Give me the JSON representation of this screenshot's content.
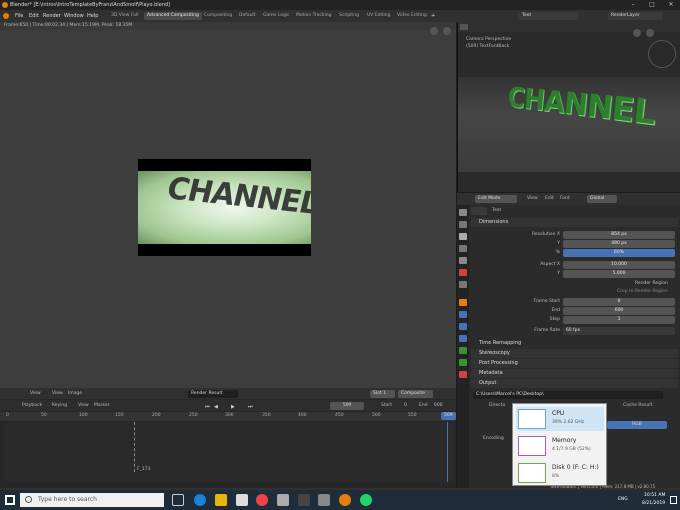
{
  "window": {
    "title": "Blender* [E:\\intros\\IntroTemplateByFranziAndSmolf\\Playo.blend]"
  },
  "menus": [
    "File",
    "Edit",
    "Render",
    "Window",
    "Help"
  ],
  "workspaces": [
    "3D View Full",
    "Advanced Compositing",
    "Compositing",
    "Default",
    "Game Logic",
    "Motion Tracking",
    "Scripting",
    "UV Editing",
    "Video Editing"
  ],
  "active_workspace_index": 1,
  "scene_name": "Text",
  "view_layer": "RenderLayer",
  "render_view": {
    "status": "Frame:650 | Time:00:02.34 | Mem:15.19M, Peak: 18.35M",
    "render_word": "CHANNEL"
  },
  "camera_view": {
    "label": "Camera Perspective",
    "sublabel": "(509) TextFontBack",
    "word": "CHANNEL"
  },
  "edit_header": {
    "mode": "Edit Mode",
    "items": [
      "View",
      "Edit",
      "Font"
    ],
    "orientation": "Global"
  },
  "properties": {
    "object_name": "Text",
    "dimensions_title": "Dimensions",
    "rows": [
      {
        "label": "Resolution X",
        "value": "854 px"
      },
      {
        "label": "Y",
        "value": "480 px"
      },
      {
        "label": "%",
        "value": "60%"
      },
      {
        "label": "Aspect X",
        "value": "10.000"
      },
      {
        "label": "Y",
        "value": "5.000"
      },
      {
        "label": "Frame Start",
        "value": "0"
      },
      {
        "label": "End",
        "value": "600"
      },
      {
        "label": "Step",
        "value": "1"
      },
      {
        "label": "Frame Rate",
        "value": "60 fps"
      }
    ],
    "render_region": "Render Region",
    "crop_region": "Crop to Render Region",
    "sections": [
      "Time Remapping",
      "Stereoscopy",
      "Post Processing",
      "Metadata",
      "Output"
    ],
    "output_path": "C:\\Users\\Marcel's PC\\Desktop\\",
    "cache_result": "Cache Result",
    "encoding": "Encoding",
    "rgb": "RGB",
    "directory_label": "Directo"
  },
  "image_editor_header": {
    "items": [
      "View",
      "View",
      "Image"
    ],
    "image_name": "Render Result",
    "slot": "Slot 1",
    "layer": "Composite"
  },
  "timeline": {
    "menus": [
      "Playback",
      "Keying",
      "View",
      "Marker"
    ],
    "current_frame": "509",
    "start_label": "Start",
    "start": "0",
    "end_label": "End",
    "end": "600",
    "ticks": [
      "0",
      "50",
      "100",
      "150",
      "200",
      "250",
      "300",
      "350",
      "400",
      "450",
      "500",
      "550"
    ],
    "playhead": "509",
    "marker": "F_173"
  },
  "statusbar": {
    "text": "TextFontBack | Verts:0/0 | Mem: 217.8 MB | v2.80.75"
  },
  "perf_popup": {
    "items": [
      {
        "name": "CPU",
        "value": "39% 2.62 GHz"
      },
      {
        "name": "Memory",
        "value": "4.1/7.9 GB (52%)"
      },
      {
        "name": "Disk 0 (F: C: H:)",
        "value": "8%"
      }
    ]
  },
  "taskbar": {
    "search_placeholder": "Type here to search",
    "time": "10:51 AM",
    "date": "8/21/2019",
    "lang": "ENG"
  },
  "colors": {
    "accent_blue": "#4772b3",
    "active_green": "#2f7d2f",
    "taskbar": "#1f2d3a"
  }
}
